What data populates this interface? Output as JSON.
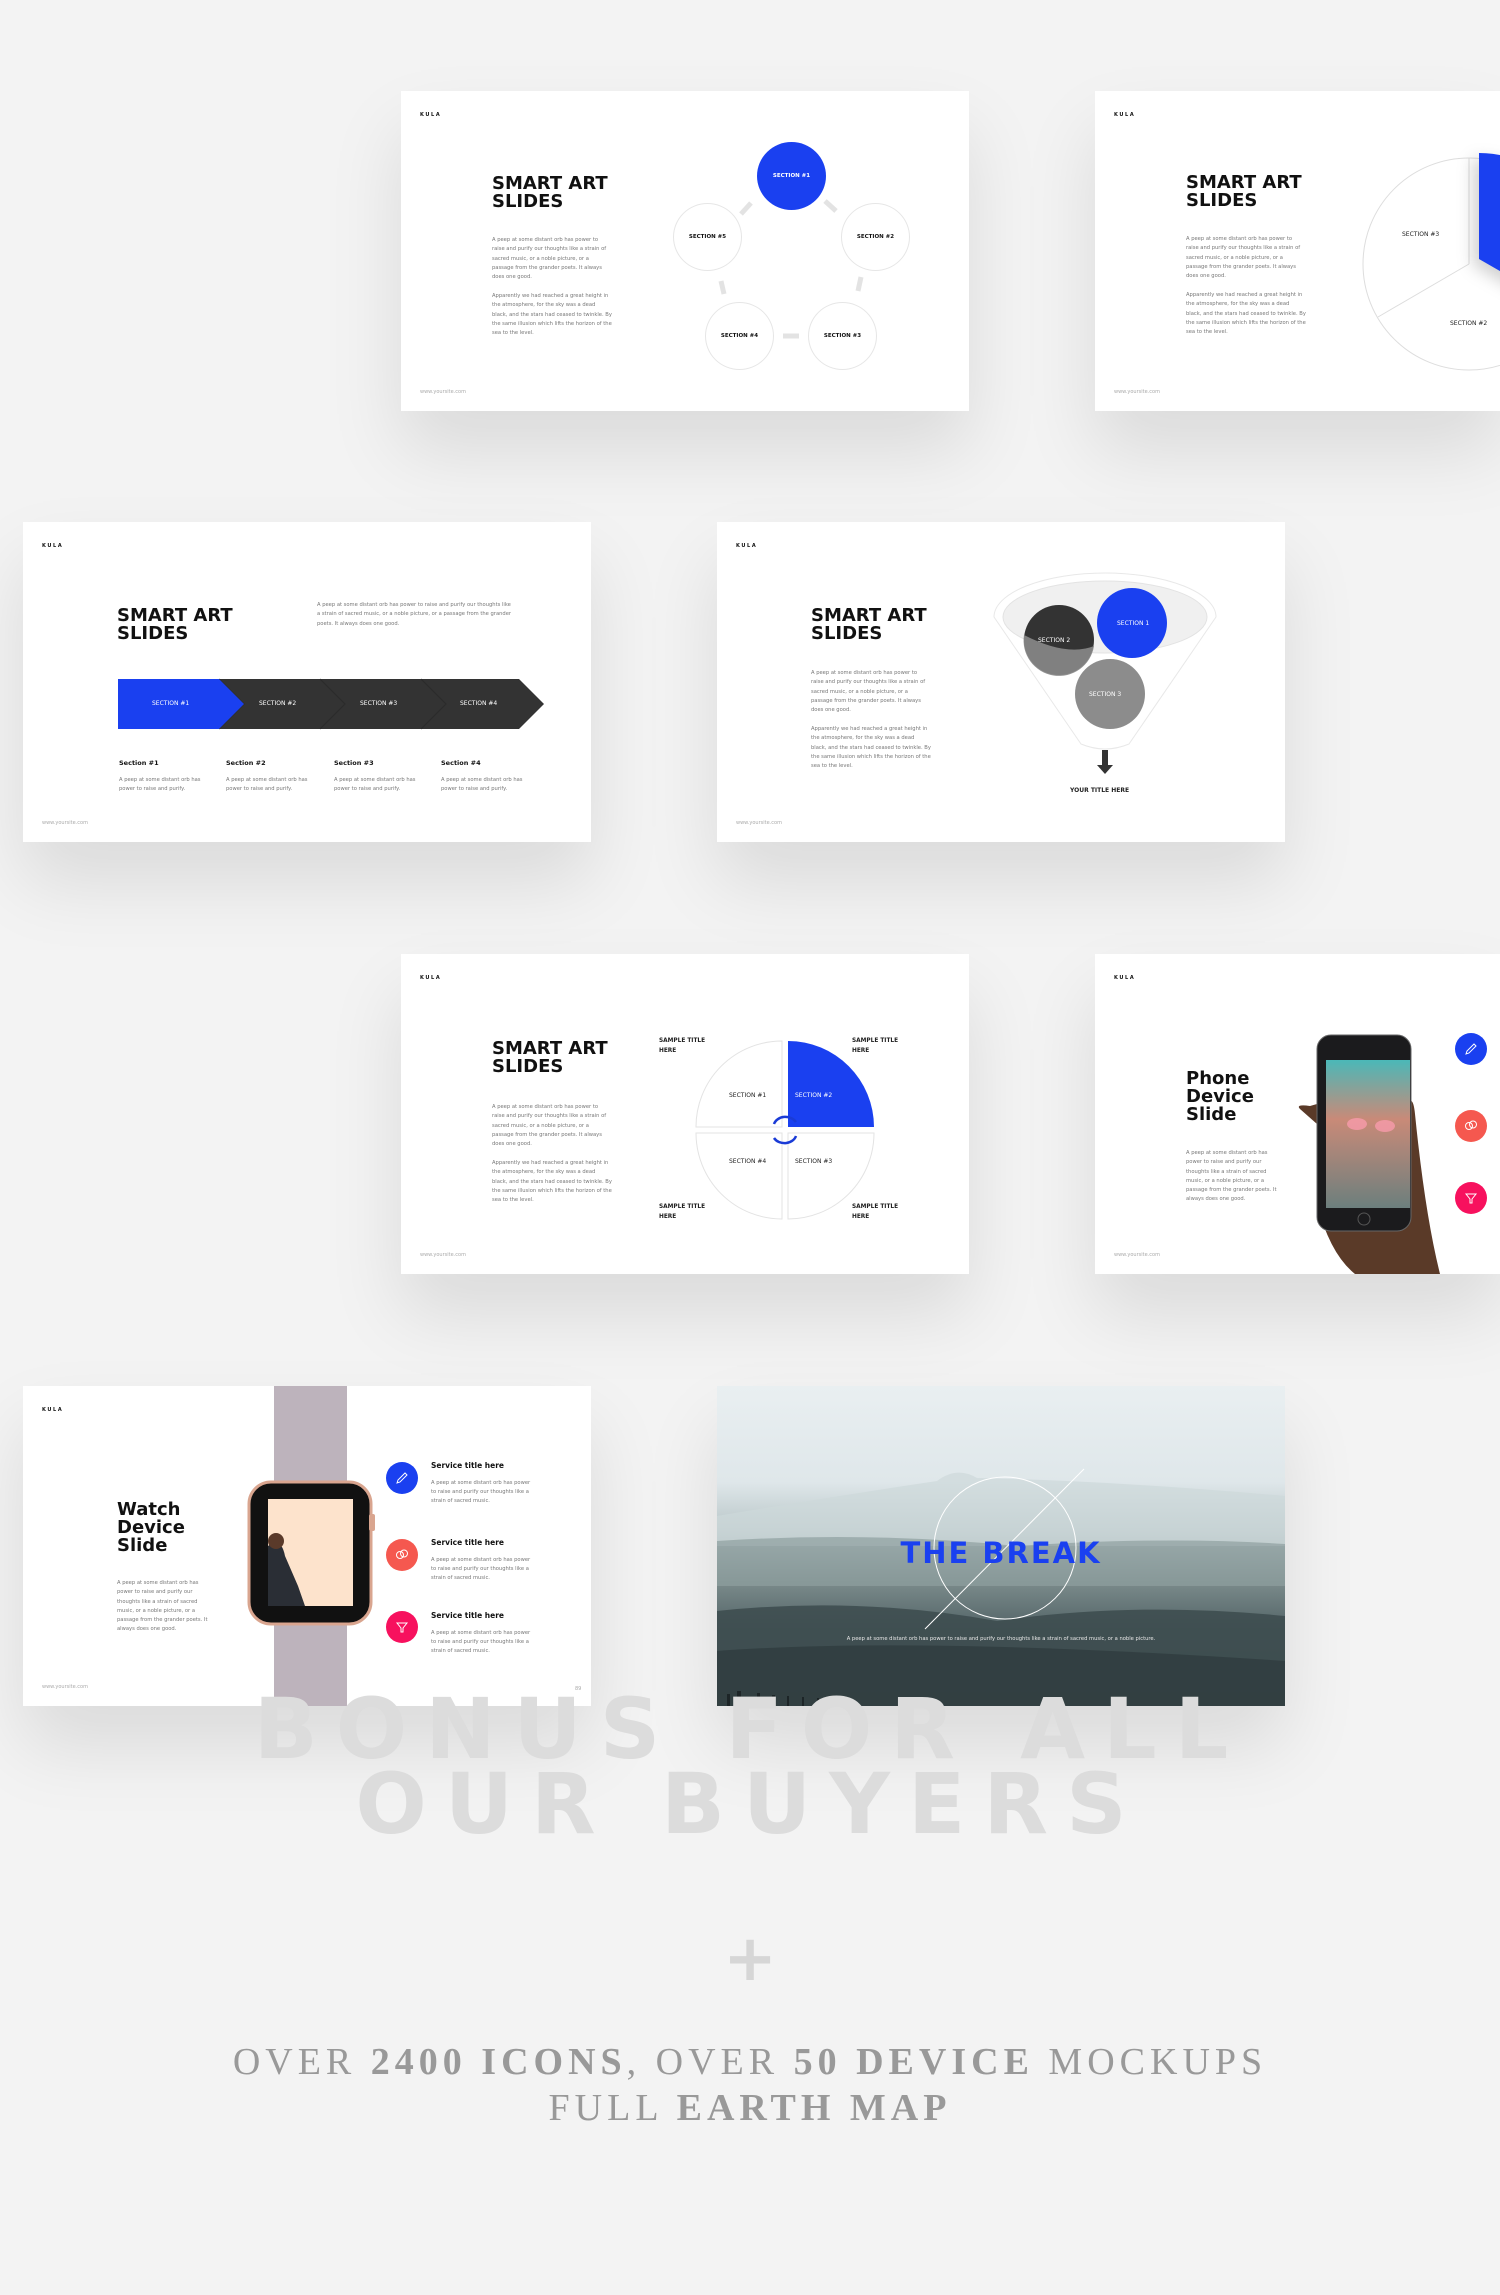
{
  "brand": "KULA",
  "site": "www.yoursite.com",
  "colors": {
    "accent": "#1a40f0",
    "coral": "#f5584f",
    "pink": "#f7115e",
    "dark": "#333333",
    "background": "#f3f3f3"
  },
  "slide_cycle": {
    "title": "SMART ART\nSLIDES",
    "p1": "A peep at some distant orb has power to raise and purify our thoughts like a strain of sacred music, or a noble picture, or a passage from the grander poets. It always does one good.",
    "p2": "Apparently we had reached a great height in the atmosphere, for the sky was a dead black, and the stars had ceased to twinkle. By the same illusion which lifts the horizon of the sea to the level.",
    "sections": [
      "SECTION #1",
      "SECTION #2",
      "SECTION #3",
      "SECTION #4",
      "SECTION #5"
    ]
  },
  "slide_pie": {
    "title": "SMART ART\nSLIDES",
    "p1": "A peep at some distant orb has power to raise and purify our thoughts like a strain of sacred music, or a noble picture, or a passage from the grander poets. It always does one good.",
    "p2": "Apparently we had reached a great height in the atmosphere, for the sky was a dead black, and the stars had ceased to twinkle. By the same illusion which lifts the horizon of the sea to the level.",
    "sections": [
      "SECTION #3",
      "SECTION #2"
    ]
  },
  "slide_chevron": {
    "title": "SMART ART\nSLIDES",
    "intro": "A peep at some distant orb has power to raise and purify our thoughts like a strain of sacred music, or a noble picture, or a passage from the grander poets. It always does one good.",
    "steps": [
      "SECTION #1",
      "SECTION #2",
      "SECTION #3",
      "SECTION #4"
    ],
    "items": [
      {
        "title": "Section #1",
        "desc": "A peep at some distant orb has power to raise and purify."
      },
      {
        "title": "Section #2",
        "desc": "A peep at some distant orb has power to raise and purify."
      },
      {
        "title": "Section #3",
        "desc": "A peep at some distant orb has power to raise and purify."
      },
      {
        "title": "Section #4",
        "desc": "A peep at some distant orb has power to raise and purify."
      }
    ]
  },
  "slide_funnel": {
    "title": "SMART ART\nSLIDES",
    "p1": "A peep at some distant orb has power to raise and purify our thoughts like a strain of sacred music, or a noble picture, or a passage from the grander poets. It always does one good.",
    "p2": "Apparently we had reached a great height in the atmosphere, for the sky was a dead black, and the stars had ceased to twinkle. By the same illusion which lifts the horizon of the sea to the level.",
    "sections": [
      "SECTION 1",
      "SECTION 2",
      "SECTION 3"
    ],
    "output": "YOUR TITLE HERE"
  },
  "slide_quadrant": {
    "title": "SMART ART\nSLIDES",
    "p1": "A peep at some distant orb has power to raise and purify our thoughts like a strain of sacred music, or a noble picture, or a passage from the grander poets. It always does one good.",
    "p2": "Apparently we had reached a great height in the atmosphere, for the sky was a dead black, and the stars had ceased to twinkle. By the same illusion which lifts the horizon of the sea to the level.",
    "sections": [
      "SECTION #1",
      "SECTION #2",
      "SECTION #3",
      "SECTION #4"
    ],
    "sample": "SAMPLE TITLE\nHERE"
  },
  "slide_phone": {
    "title": "Phone\nDevice\nSlide",
    "p1": "A peep at some distant orb has power to raise and purify our thoughts like a strain of sacred music, or a noble picture, or a passage from the grander poets. It always does one good.",
    "icons": [
      "pencil-icon",
      "chat-icon",
      "funnel-icon"
    ]
  },
  "slide_watch": {
    "title": "Watch\nDevice\nSlide",
    "p1": "A peep at some distant orb has power to raise and purify our thoughts like a strain of sacred music, or a noble picture, or a passage from the grander poets. It always does one good.",
    "services": [
      {
        "title": "Service title here",
        "desc": "A peep at some distant orb has power to raise and purify our thoughts like a strain of sacred music.",
        "icon": "pencil-icon"
      },
      {
        "title": "Service title here",
        "desc": "A peep at some distant orb has power to raise and purify our thoughts like a strain of sacred music.",
        "icon": "chat-icon"
      },
      {
        "title": "Service title here",
        "desc": "A peep at some distant orb has power to raise and purify our thoughts like a strain of sacred music.",
        "icon": "funnel-icon"
      }
    ],
    "page_number": "89"
  },
  "slide_break": {
    "title": "THE BREAK",
    "caption": "A peep at some distant orb has power to raise and purify our thoughts like a strain of sacred music, or a noble picture."
  },
  "bonus": {
    "line1": "BONUS FOR ALL",
    "line2": "OUR BUYERS",
    "plus": "+",
    "features_line1": {
      "a": "OVER ",
      "b": "2400 ICONS",
      ",c": "",
      "c": ", OVER ",
      "d": "50 DEVICE",
      "e": " MOCKUPS"
    },
    "features_line2": {
      "a": "FULL ",
      "b": "EARTH MAP"
    }
  }
}
